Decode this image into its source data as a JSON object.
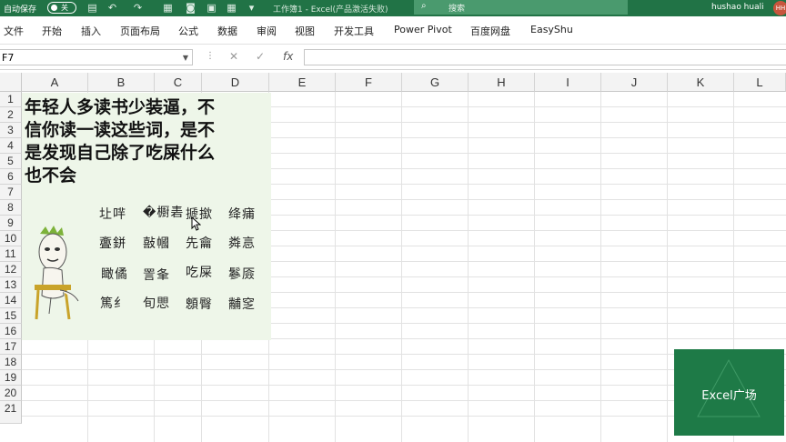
{
  "titlebar": {
    "autosave_label": "自动保存",
    "autosave_state": "关",
    "window_title": "工作簿1 - Excel(产品激活失败)",
    "search_placeholder": "搜索",
    "user_name": "hushao huali",
    "avatar_initials": "HH"
  },
  "ribbon": {
    "tabs": [
      "文件",
      "开始",
      "插入",
      "页面布局",
      "公式",
      "数据",
      "审阅",
      "视图",
      "开发工具",
      "Power Pivot",
      "百度网盘",
      "EasyShu"
    ]
  },
  "formula_bar": {
    "name_box": "F7",
    "fx_label": "fx",
    "formula": ""
  },
  "grid": {
    "columns": [
      "A",
      "B",
      "C",
      "D",
      "E",
      "F",
      "G",
      "H",
      "I",
      "J",
      "K",
      "L"
    ],
    "rows": [
      "1",
      "2",
      "3",
      "4",
      "5",
      "6",
      "7",
      "8",
      "9",
      "10",
      "11",
      "12",
      "13",
      "14",
      "15",
      "16",
      "17",
      "18",
      "19",
      "20",
      "21"
    ]
  },
  "picture": {
    "headline_lines": [
      "年轻人多读书少装逼，不",
      "信你读一读这些词，是不",
      "是发现自己除了吃屎什么",
      "也不会"
    ],
    "words": [
      [
        "圵哶",
        "�櫉砉",
        "搋撳",
        "绛痡"
      ],
      [
        "斖鉼",
        "敼幗",
        "先龠",
        "粦悥"
      ],
      [
        "瞰僪",
        "詈夆",
        "吃屎",
        "鬖厱"
      ],
      [
        "篤纟",
        "旬愳",
        "顖臀",
        "黼窆"
      ]
    ]
  },
  "watermark": {
    "label": "Excel广场"
  }
}
